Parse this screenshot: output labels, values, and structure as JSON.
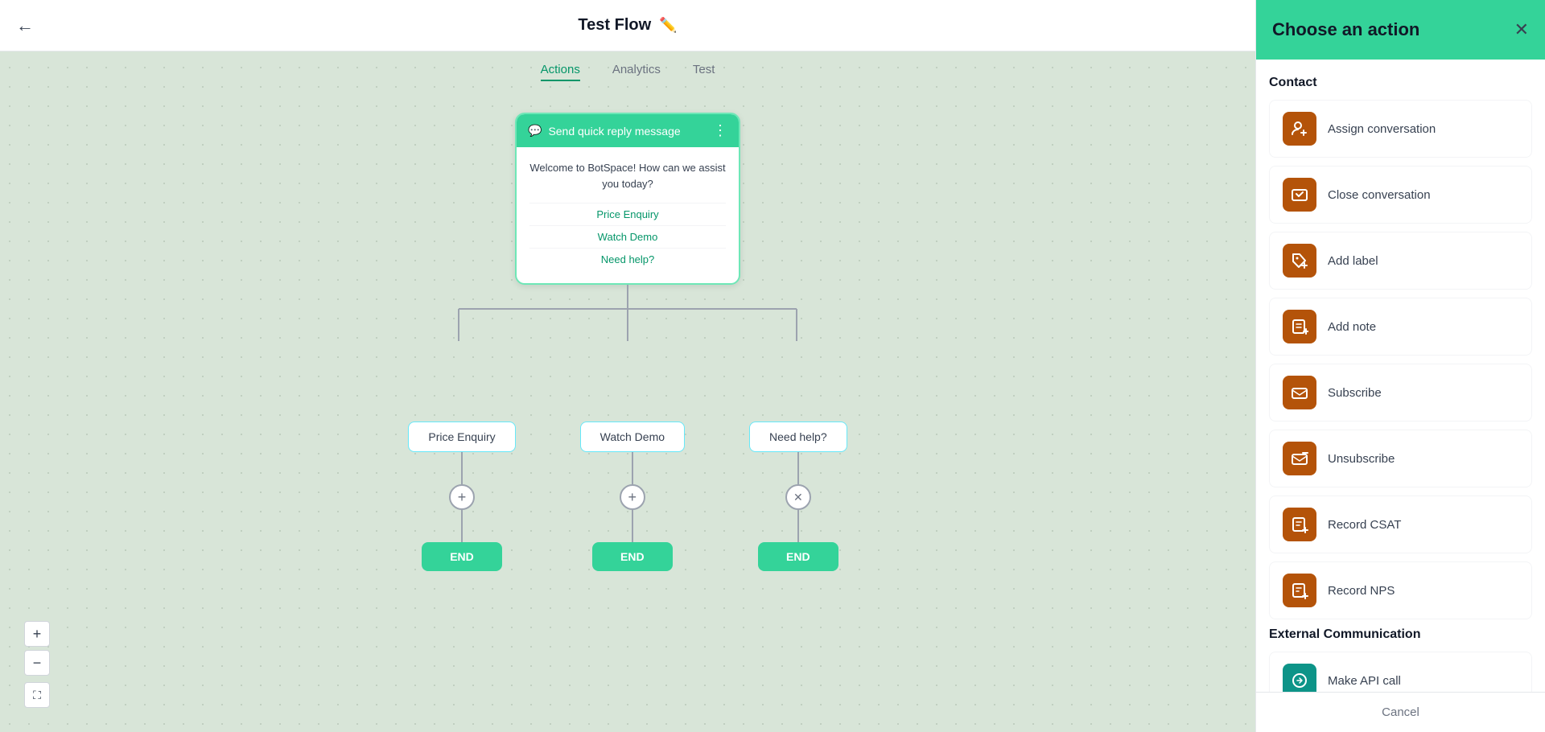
{
  "topbar": {
    "back_label": "←",
    "title": "Test Flow",
    "edit_icon": "✏️"
  },
  "tabs": [
    {
      "id": "actions",
      "label": "Actions",
      "active": true
    },
    {
      "id": "analytics",
      "label": "Analytics",
      "active": false
    },
    {
      "id": "test",
      "label": "Test",
      "active": false
    }
  ],
  "flow": {
    "message_node": {
      "header": "Send quick reply message",
      "body": "Welcome to BotSpace! How can we assist you today?",
      "replies": [
        "Price Enquiry",
        "Watch Demo",
        "Need help?"
      ]
    },
    "branches": [
      {
        "label": "Price Enquiry",
        "end": "END",
        "connector_type": "plus"
      },
      {
        "label": "Watch Demo",
        "end": "END",
        "connector_type": "plus"
      },
      {
        "label": "Need help?",
        "end": "END",
        "connector_type": "x"
      }
    ]
  },
  "zoom": {
    "plus": "+",
    "minus": "−",
    "fullscreen": "⛶"
  },
  "panel": {
    "title": "Choose an action",
    "close_icon": "✕",
    "sections": [
      {
        "title": "Contact",
        "actions": [
          {
            "id": "assign-conversation",
            "label": "Assign conversation",
            "icon": "👤+"
          },
          {
            "id": "close-conversation",
            "label": "Close conversation",
            "icon": "💬✕"
          },
          {
            "id": "add-label",
            "label": "Add label",
            "icon": "🏷+"
          },
          {
            "id": "add-note",
            "label": "Add note",
            "icon": "📄+"
          },
          {
            "id": "subscribe",
            "label": "Subscribe",
            "icon": "✉️"
          },
          {
            "id": "unsubscribe",
            "label": "Unsubscribe",
            "icon": "✉️−"
          },
          {
            "id": "record-csat",
            "label": "Record CSAT",
            "icon": "📊"
          },
          {
            "id": "record-nps",
            "label": "Record NPS",
            "icon": "📋+"
          }
        ]
      },
      {
        "title": "External Communication",
        "actions": [
          {
            "id": "make-api-call",
            "label": "Make API call",
            "icon": "🔗"
          }
        ]
      }
    ],
    "cancel_label": "Cancel"
  }
}
